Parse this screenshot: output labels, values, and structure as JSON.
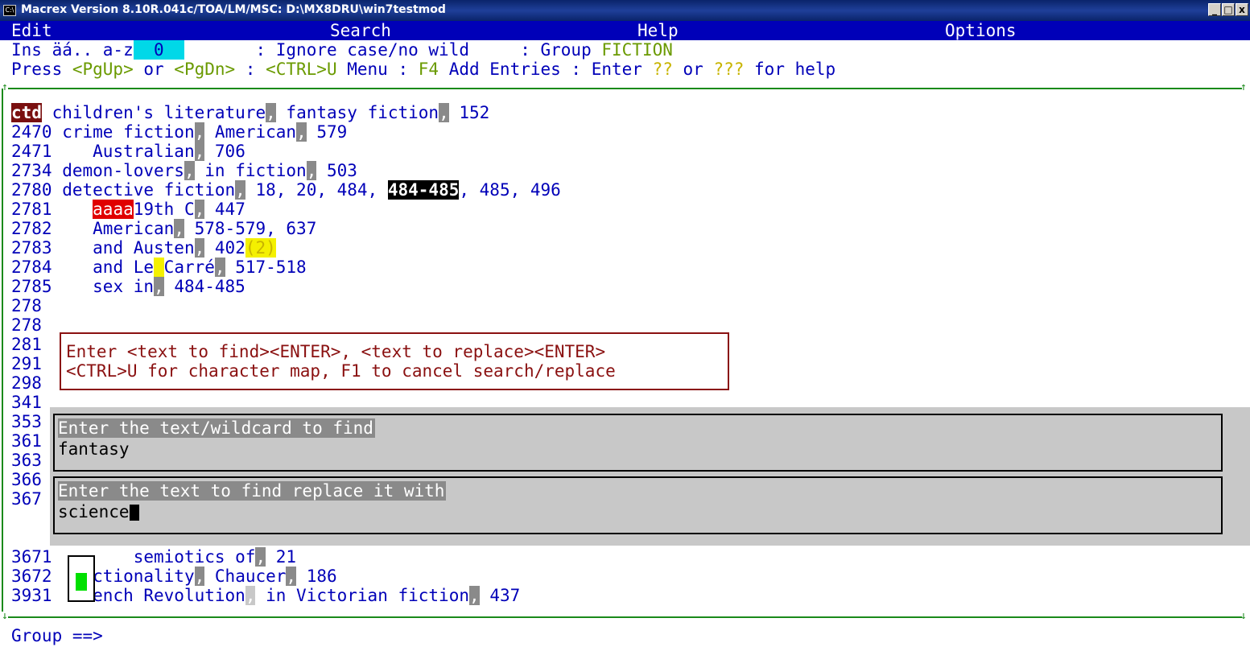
{
  "window": {
    "title": "Macrex Version 8.10R.041c/TOA/LM/MSC: D:\\MX8DRU\\win7testmod",
    "sys_icon": "C:\\",
    "buttons": {
      "minimize": "_",
      "maximize": "□",
      "close": "x"
    }
  },
  "menu": {
    "items": [
      {
        "hot": "E",
        "rest": "dit"
      },
      {
        "hot": "S",
        "rest": "earch"
      },
      {
        "hot": "H",
        "rest": "elp"
      },
      {
        "hot": "O",
        "rest": "ptions"
      }
    ]
  },
  "status": {
    "mode": "Ins äá.. a-z",
    "count": "0",
    "case": ": Ignore case/no wild",
    "group_prefix": ": Group ",
    "group_name": "FICTION"
  },
  "hint": {
    "p1": "Press ",
    "k1": "<PgUp>",
    "p2": " or ",
    "k2": "<PgDn>",
    "p3": " : ",
    "k3": "<CTRL>U",
    "p4": " Menu : ",
    "k4": "F4",
    "p5": " Add Entries : Enter ",
    "k5": "??",
    "p6": " or ",
    "k6": "???",
    "p7": " for help"
  },
  "entries": [
    {
      "num": "ctd",
      "indent": "",
      "tag": "",
      "heading": "children's literature",
      "sub": "fantasy fiction",
      "locator": "152"
    },
    {
      "num": "2470",
      "indent": "",
      "tag": "",
      "heading": "crime fiction",
      "sub": "American",
      "locator": "579"
    },
    {
      "num": "2471",
      "indent": "   ",
      "tag": "",
      "heading": "Australian",
      "sub": "",
      "locator": "706"
    },
    {
      "num": "2734",
      "indent": "",
      "tag": "",
      "heading": "demon-lovers",
      "sub": "in fiction",
      "locator": "503"
    },
    {
      "num": "2780",
      "indent": "",
      "tag": "",
      "heading": "detective fiction",
      "sub": "",
      "locator": "18, 20, 484, ",
      "locator_hl": "484-485",
      "locator_tail": ", 485, 496"
    },
    {
      "num": "2781",
      "indent": "   ",
      "tag": "aaaa",
      "heading": "19th C",
      "sub": "",
      "locator": "447"
    },
    {
      "num": "2782",
      "indent": "   ",
      "tag": "",
      "heading": "American",
      "sub": "",
      "locator": "578-579, 637"
    },
    {
      "num": "2783",
      "indent": "   ",
      "tag": "",
      "heading": "and Austen",
      "sub": "",
      "locator": "402",
      "locator_yel": "(2)"
    },
    {
      "num": "2784",
      "indent": "   ",
      "tag": "",
      "heading_a": "and Le",
      "heading_b": "Carré",
      "sub": "",
      "locator": "517-518"
    },
    {
      "num": "2785",
      "indent": "   ",
      "tag": "",
      "heading": "sex in",
      "sub": "",
      "locator": "484-485"
    }
  ],
  "partial_nums": [
    "278",
    "278",
    "281",
    "291",
    "298",
    "341",
    "353",
    "361",
    "363",
    "366",
    "367"
  ],
  "message_box": {
    "line1": "Enter <text to find><ENTER>, <text to replace><ENTER>",
    "line2": "<CTRL>U for character map, F1 to cancel search/replace"
  },
  "dialog": {
    "find_caption": "Enter the text/wildcard to find",
    "find_value": "fantasy",
    "replace_caption": "Enter the text to find replace it with",
    "replace_value": "science"
  },
  "lower_entries": [
    {
      "num": "3671",
      "text_a": "  semiotics of",
      "loc": "21"
    },
    {
      "num": "3672",
      "text_a": "ctionality",
      "text_b": "Chaucer",
      "loc": "186"
    },
    {
      "num": "3931",
      "text_a": "ench Revolution",
      "text_b": "in Victorian fiction",
      "loc": "437"
    }
  ],
  "bottom": {
    "prompt": "Group ==>"
  },
  "colors": {
    "title_bar": "#0a246a",
    "menu_bar": "#0000b8",
    "accent_green": "#1a8a1a",
    "message_red": "#8a1010",
    "dialog_gray": "#c8c8c8"
  }
}
